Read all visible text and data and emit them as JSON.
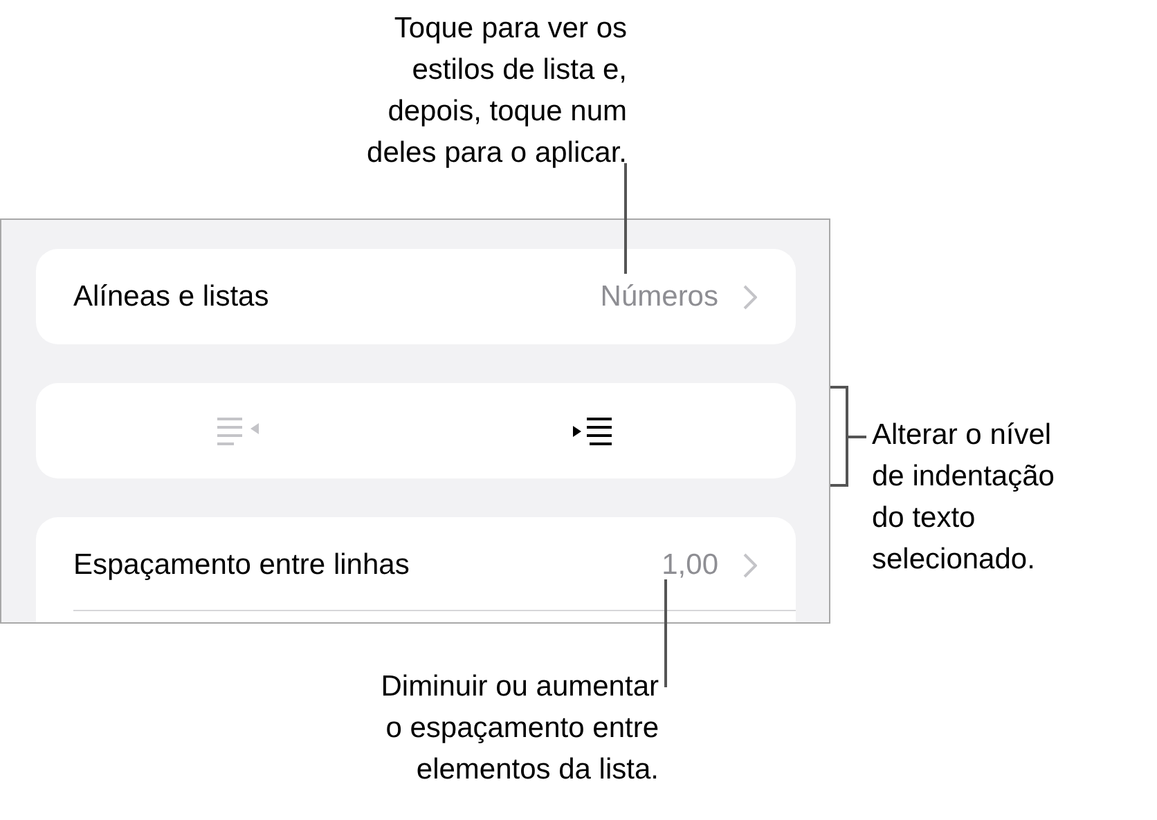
{
  "panel": {
    "rows": [
      {
        "kind": "disclosure",
        "label": "Alíneas e listas",
        "value": "Números"
      },
      {
        "kind": "indent-buttons",
        "buttons": [
          {
            "kind": "outdent",
            "disabled": true
          },
          {
            "kind": "indent",
            "disabled": false
          }
        ]
      },
      {
        "kind": "disclosure",
        "label": "Espaçamento entre linhas",
        "value": "1,00"
      }
    ]
  },
  "callouts": [
    {
      "kind": "top",
      "text": "Toque para ver os\nestilos de lista e,\ndepois, toque num\ndeles para o aplicar."
    },
    {
      "kind": "bracket",
      "text": "Alterar o nível\nde indentação\ndo texto\nselecionado."
    },
    {
      "kind": "bottom",
      "text": "Diminuir ou aumentar\no espaçamento entre\nelementos da lista."
    }
  ]
}
